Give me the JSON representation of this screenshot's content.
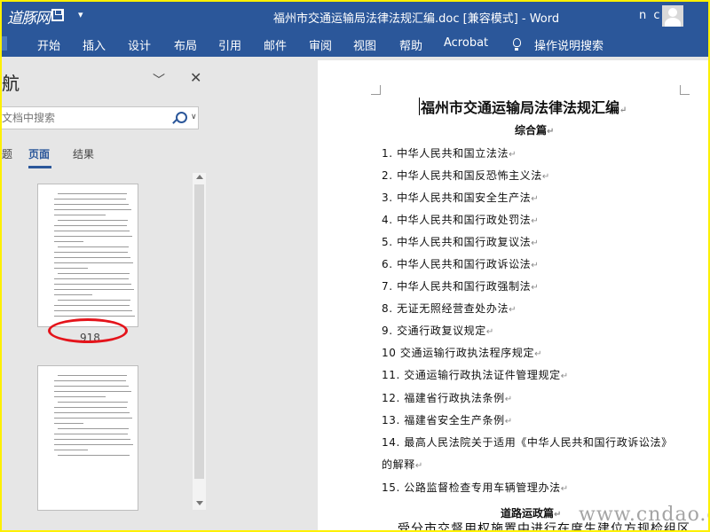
{
  "window": {
    "logo_text": "道豚网",
    "doc_title": "福州市交通运输局法律法规汇编.doc [兼容模式] - Word",
    "user": "n c"
  },
  "ribbon": {
    "tabs": [
      "开始",
      "插入",
      "设计",
      "布局",
      "引用",
      "邮件",
      "审阅",
      "视图",
      "帮助",
      "Acrobat"
    ],
    "tell_me": "操作说明搜索"
  },
  "nav": {
    "title": "航",
    "search_placeholder": "文档中搜索",
    "tabs": [
      "题",
      "页面",
      "结果"
    ],
    "active_tab": "页面",
    "page_number": "918"
  },
  "document": {
    "heading": "福州市交通运输局法律法规汇编",
    "subheading": "综合篇",
    "items": [
      "1. 中华人民共和国立法法",
      "2. 中华人民共和国反恐怖主义法",
      "3. 中华人民共和国安全生产法",
      "4. 中华人民共和国行政处罚法",
      "5. 中华人民共和国行政复议法",
      "6. 中华人民共和国行政诉讼法",
      "7. 中华人民共和国行政强制法",
      "8. 无证无照经营查处办法",
      "9. 交通行政复议规定",
      "10 交通运输行政执法程序规定",
      "11. 交通运输行政执法证件管理规定",
      "12. 福建省行政执法条例",
      "13. 福建省安全生产条例",
      "14. 最高人民法院关于适用《中华人民共和国行政诉讼法》",
      "的解释",
      "15. 公路监督检查专用车辆管理办法"
    ],
    "subheading2": "道路运政篇",
    "bottom_text": "受分市交督用权施置中进行在度生建位方规检组区",
    "watermark": "www.cndao.com"
  },
  "colors": {
    "ribbon_blue": "#2b579a",
    "annotation_red": "#e4141b",
    "border_yellow": "#fdf000"
  }
}
